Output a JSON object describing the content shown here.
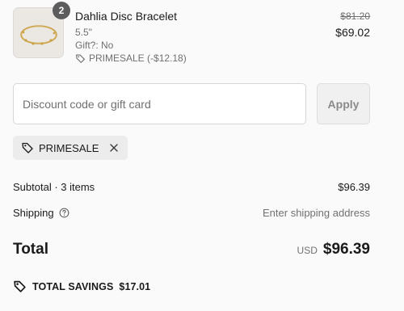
{
  "product": {
    "quantity": "2",
    "name": "Dahlia Disc Bracelet",
    "size": "5.5\"",
    "gift": "Gift?: No",
    "discount": "PRIMESALE (-$12.18)",
    "original_price": "$81.20",
    "price": "$69.02"
  },
  "discount_form": {
    "placeholder": "Discount code or gift card",
    "apply_label": "Apply"
  },
  "applied_code": {
    "code": "PRIMESALE"
  },
  "totals": {
    "subtotal_label": "Subtotal · 3 items",
    "subtotal_value": "$96.39",
    "shipping_label": "Shipping",
    "shipping_value": "Enter shipping address",
    "total_label": "Total",
    "currency": "USD",
    "total_value": "$96.39",
    "savings_label": "TOTAL SAVINGS",
    "savings_value": "$17.01"
  },
  "icons": {
    "tag": "tag-icon",
    "close": "close-icon",
    "help": "help-circle-icon",
    "product_image": "bracelet-image"
  }
}
